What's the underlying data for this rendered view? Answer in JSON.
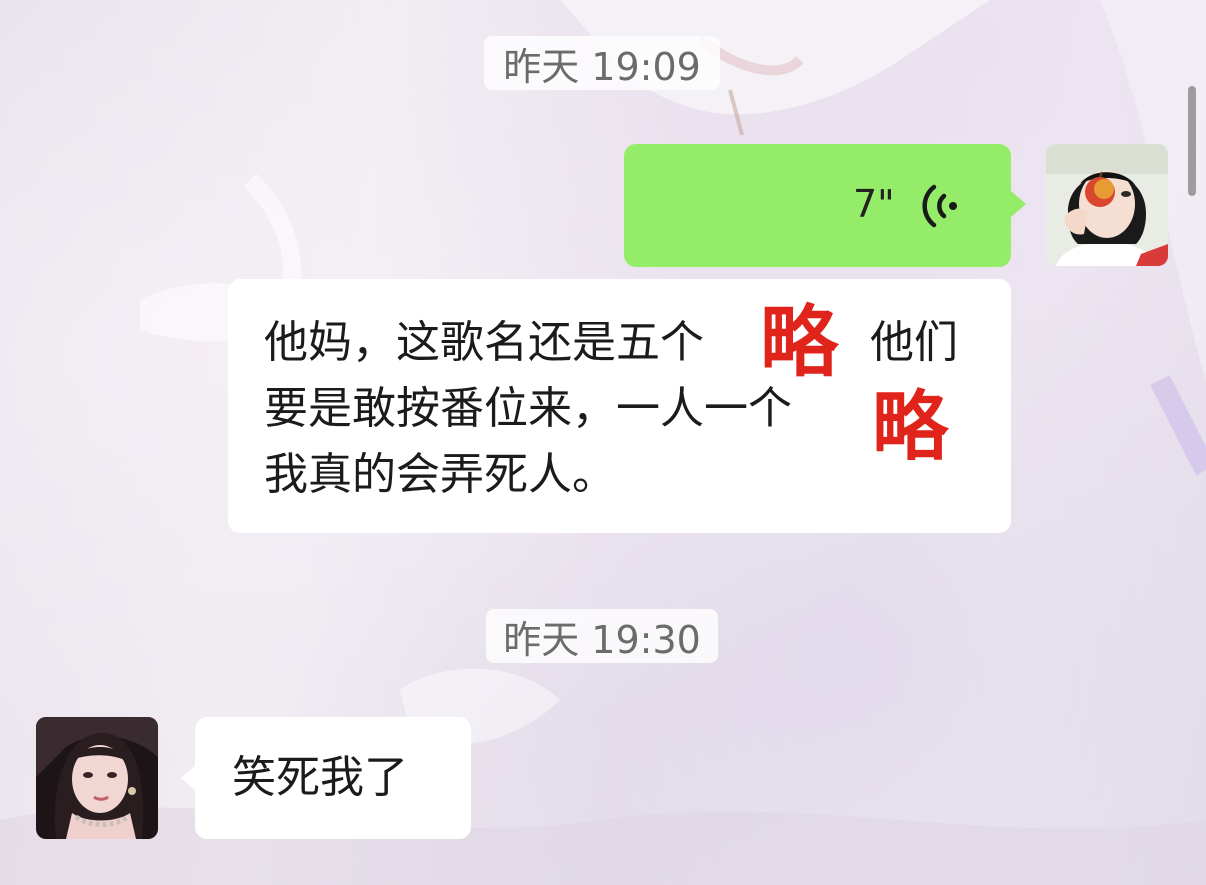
{
  "timestamps": [
    "昨天 19:09",
    "昨天 19:30"
  ],
  "messages": [
    {
      "sender": "self",
      "type": "voice",
      "duration": "7\""
    },
    {
      "sender": "self",
      "type": "text",
      "lines": [
        "他妈，这歌名还是五个",
        "他们",
        "要是敢按番位来，一人一个",
        "我真的会弄死人。"
      ],
      "redaction_stamp": "略"
    },
    {
      "sender": "other",
      "type": "text",
      "text": "笑死我了"
    }
  ],
  "icons": {
    "voice": "voice-wave-icon"
  },
  "colors": {
    "self_bubble": "#95ec69",
    "other_bubble": "#ffffff",
    "redaction": "#e0241b"
  }
}
